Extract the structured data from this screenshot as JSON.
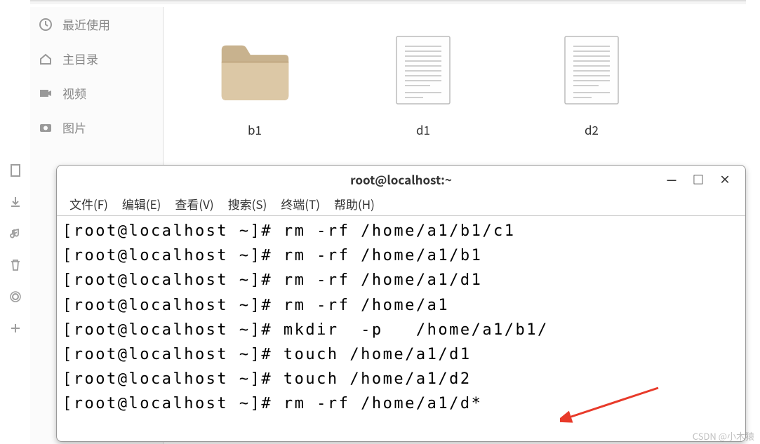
{
  "sidebar": {
    "items": [
      {
        "label": "最近使用",
        "icon": "clock-icon"
      },
      {
        "label": "主目录",
        "icon": "home-icon"
      },
      {
        "label": "视频",
        "icon": "video-icon"
      },
      {
        "label": "图片",
        "icon": "camera-icon"
      }
    ]
  },
  "file_items": [
    {
      "label": "b1",
      "type": "folder"
    },
    {
      "label": "d1",
      "type": "file"
    },
    {
      "label": "d2",
      "type": "file"
    }
  ],
  "leftstrip": {
    "icons": [
      "document-icon",
      "download-icon",
      "music-icon",
      "trash-icon",
      "computer-icon",
      "plus-icon"
    ]
  },
  "terminal": {
    "title": "root@localhost:~",
    "controls": {
      "min": "—",
      "max": "□",
      "close": "×"
    },
    "menus": [
      "文件(F)",
      "编辑(E)",
      "查看(V)",
      "搜索(S)",
      "终端(T)",
      "帮助(H)"
    ],
    "lines": [
      "[root@localhost ~]# rm -rf /home/a1/b1/c1",
      "[root@localhost ~]# rm -rf /home/a1/b1",
      "[root@localhost ~]# rm -rf /home/a1/d1",
      "[root@localhost ~]# rm -rf /home/a1",
      "[root@localhost ~]# mkdir  -p   /home/a1/b1/",
      "[root@localhost ~]# touch /home/a1/d1",
      "[root@localhost ~]# touch /home/a1/d2",
      "[root@localhost ~]# rm -rf /home/a1/d*"
    ]
  },
  "watermark": "CSDN @小木猿"
}
